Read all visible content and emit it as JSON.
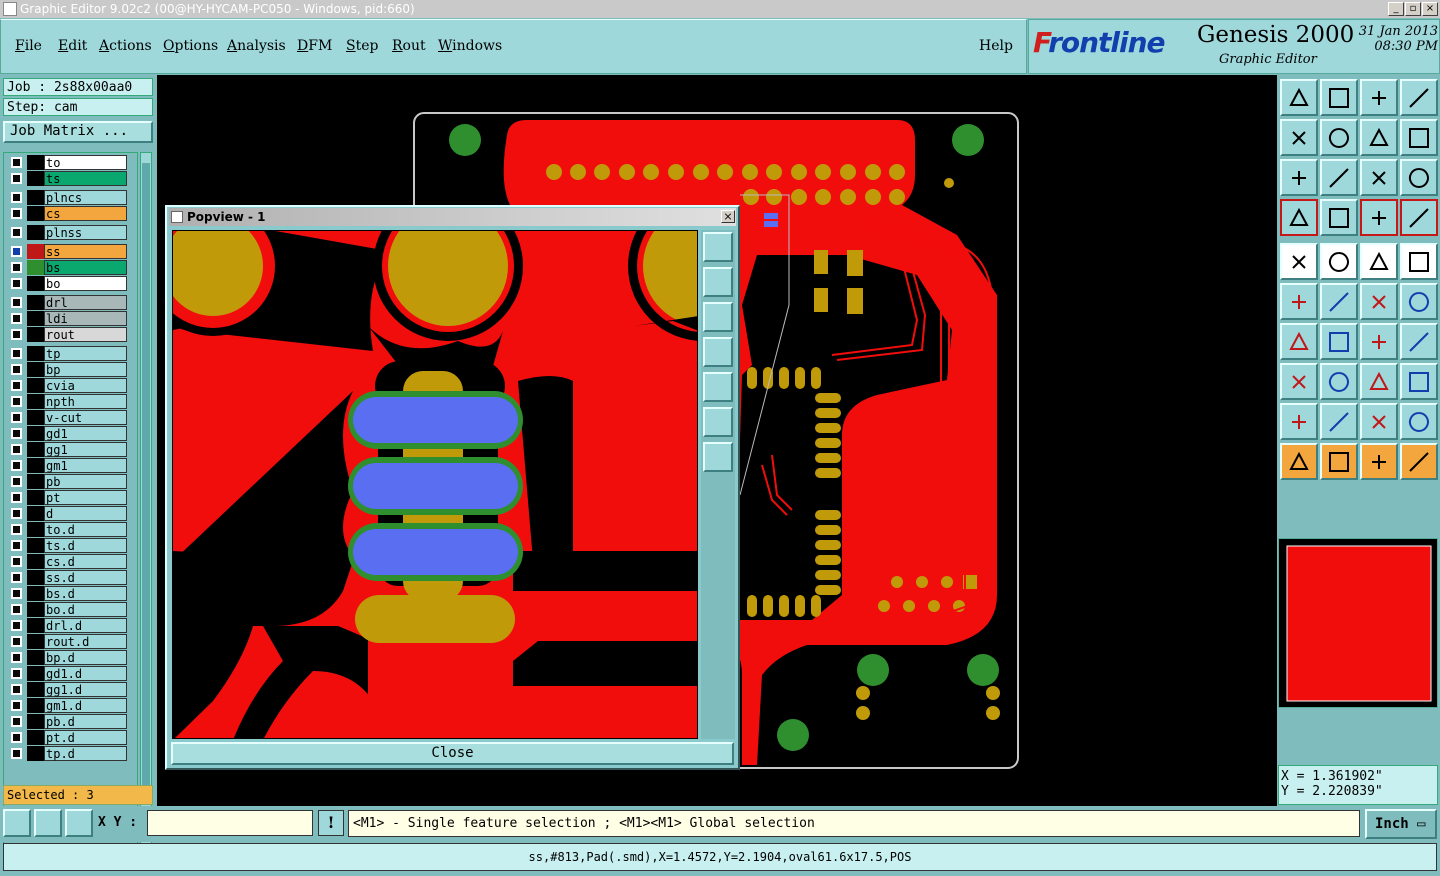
{
  "window": {
    "title": "Graphic Editor 9.02c2 (00@HY-HYCAM-PC050 - Windows, pid:660)"
  },
  "menu": [
    {
      "label": "File",
      "u": "F",
      "rest": "ile"
    },
    {
      "label": "Edit",
      "u": "E",
      "rest": "dit"
    },
    {
      "label": "Actions",
      "u": "A",
      "rest": "ctions"
    },
    {
      "label": "Options",
      "u": "O",
      "rest": "ptions"
    },
    {
      "label": "Analysis",
      "u": "A",
      "rest": "nalysis"
    },
    {
      "label": "DFM",
      "u": "D",
      "rest": "FM"
    },
    {
      "label": "Step",
      "u": "S",
      "rest": "tep"
    },
    {
      "label": "Rout",
      "u": "R",
      "rest": "out"
    },
    {
      "label": "Windows",
      "u": "W",
      "rest": "indows"
    },
    {
      "label": "Help",
      "u": "",
      "rest": "Help"
    }
  ],
  "brand": {
    "logo_f": "F",
    "logo_rest": "rontline",
    "product": "Genesis 2000",
    "subtitle": "Graphic Editor",
    "date": "31 Jan 2013",
    "time": "08:30 PM"
  },
  "job": {
    "job_label": "Job : 2s88x00aa0",
    "step_label": "Step: cam",
    "matrix_button": "Job Matrix ..."
  },
  "layers": [
    {
      "name": "to",
      "color": "#ffffff",
      "swatch": "#000000"
    },
    {
      "name": "ts",
      "color": "#0aa86e",
      "swatch": "#000000"
    },
    {
      "name": "plncs",
      "color": "#9ed8db",
      "swatch": "#000000"
    },
    {
      "name": "cs",
      "color": "#f2a63d",
      "swatch": "#000000"
    },
    {
      "name": "plnss",
      "color": "#9ed8db",
      "swatch": "#000000"
    },
    {
      "name": "ss",
      "color": "#f2a63d",
      "swatch": "#c01818",
      "active": true
    },
    {
      "name": "bs",
      "color": "#0aa86e",
      "swatch": "#2f8f2f"
    },
    {
      "name": "bo",
      "color": "#ffffff",
      "swatch": "#000000"
    },
    {
      "name": "drl",
      "color": "#a8b7b8",
      "swatch": "#000000"
    },
    {
      "name": "ldi",
      "color": "#a8b7b8",
      "swatch": "#000000"
    },
    {
      "name": "rout",
      "color": "#d8d8d8",
      "swatch": "#000000"
    },
    {
      "name": "tp",
      "color": "#9ed8db",
      "swatch": "#000000"
    },
    {
      "name": "bp",
      "color": "#9ed8db",
      "swatch": "#000000"
    },
    {
      "name": "cvia",
      "color": "#9ed8db",
      "swatch": "#000000"
    },
    {
      "name": "npth",
      "color": "#9ed8db",
      "swatch": "#000000"
    },
    {
      "name": "v-cut",
      "color": "#9ed8db",
      "swatch": "#000000"
    },
    {
      "name": "gd1",
      "color": "#9ed8db",
      "swatch": "#000000"
    },
    {
      "name": "gg1",
      "color": "#9ed8db",
      "swatch": "#000000"
    },
    {
      "name": "gm1",
      "color": "#9ed8db",
      "swatch": "#000000"
    },
    {
      "name": "pb",
      "color": "#9ed8db",
      "swatch": "#000000"
    },
    {
      "name": "pt",
      "color": "#9ed8db",
      "swatch": "#000000"
    },
    {
      "name": "d",
      "color": "#9ed8db",
      "swatch": "#000000"
    },
    {
      "name": "to.d",
      "color": "#9ed8db",
      "swatch": "#000000"
    },
    {
      "name": "ts.d",
      "color": "#9ed8db",
      "swatch": "#000000"
    },
    {
      "name": "cs.d",
      "color": "#9ed8db",
      "swatch": "#000000"
    },
    {
      "name": "ss.d",
      "color": "#9ed8db",
      "swatch": "#000000"
    },
    {
      "name": "bs.d",
      "color": "#9ed8db",
      "swatch": "#000000"
    },
    {
      "name": "bo.d",
      "color": "#9ed8db",
      "swatch": "#000000"
    },
    {
      "name": "drl.d",
      "color": "#9ed8db",
      "swatch": "#000000"
    },
    {
      "name": "rout.d",
      "color": "#9ed8db",
      "swatch": "#000000"
    },
    {
      "name": "bp.d",
      "color": "#9ed8db",
      "swatch": "#000000"
    },
    {
      "name": "gd1.d",
      "color": "#9ed8db",
      "swatch": "#000000"
    },
    {
      "name": "gg1.d",
      "color": "#9ed8db",
      "swatch": "#000000"
    },
    {
      "name": "gm1.d",
      "color": "#9ed8db",
      "swatch": "#000000"
    },
    {
      "name": "pb.d",
      "color": "#9ed8db",
      "swatch": "#000000"
    },
    {
      "name": "pt.d",
      "color": "#9ed8db",
      "swatch": "#000000"
    },
    {
      "name": "tp.d",
      "color": "#9ed8db",
      "swatch": "#000000"
    }
  ],
  "selected_text": "Selected : 3",
  "popview": {
    "title": "Popview - 1",
    "close_label": "Close"
  },
  "coords": {
    "x": "X = 1.361902\"",
    "y": "Y = 2.220839\""
  },
  "bottom": {
    "xy_label": "X Y :",
    "xy_value": "",
    "info_glyph": "!",
    "prompt": "<M1> - Single feature selection ; <M1><M1> Global selection",
    "unit": "Inch"
  },
  "status": "ss,#813,Pad(.smd),X=1.4572,Y=2.1904,oval61.6x17.5,POS",
  "tools": [
    "layer-up-icon",
    "layer-down-icon",
    "home-icon",
    "split-view-icon",
    "pan-left-icon",
    "pan-right-icon",
    "undo-view-icon",
    "redraw-icon",
    "zoom-fit-icon",
    "zoom-center-icon",
    "zoom-1-2-icon",
    "help-icon",
    "snap-grid-icon",
    "measure-icon",
    "net-select-icon",
    "net-highlight-icon",
    "feature-info-icon",
    "edit-shape-icon",
    "ruler-icon",
    "pad-icon",
    "connect-icon",
    "cross-icon",
    "line-add-icon",
    "line-move-icon",
    "angle-icon",
    "slash-icon",
    "arc-icon",
    "align-icon",
    "move-pad-icon",
    "bar-icon",
    "dimension-icon",
    "group-icon",
    "triangle-icon",
    "text-up-icon",
    "text-a-icon",
    "text-a2-icon",
    "pointer-icon",
    "pointer-box-icon",
    "pointer-orange-icon",
    "route-icon"
  ]
}
